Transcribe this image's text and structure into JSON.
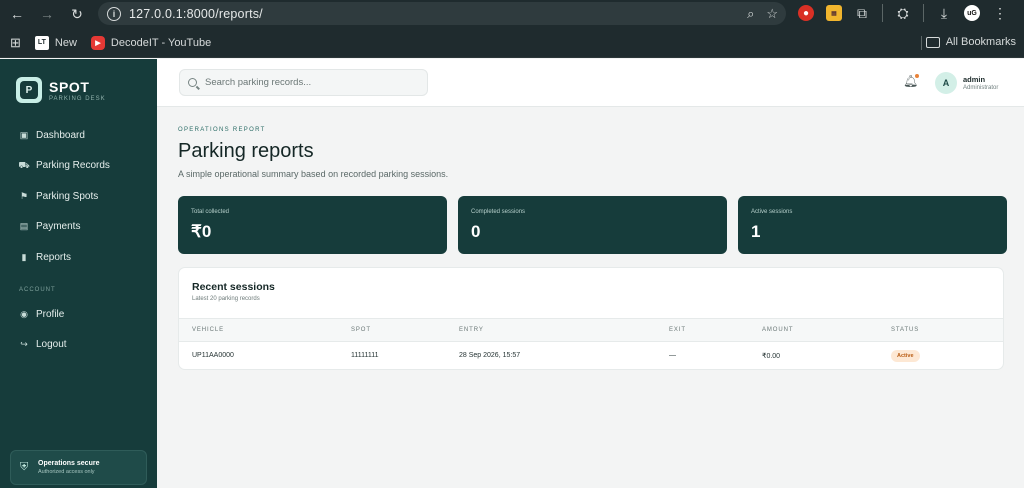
{
  "browser": {
    "url": "127.0.0.1:8000/reports/",
    "bookmarks": [
      {
        "label": "New",
        "icon": "lit"
      },
      {
        "label": "DecodeIT - YouTube",
        "icon": "yt"
      }
    ],
    "all_bookmarks": "All Bookmarks",
    "profile_initials": "uG"
  },
  "brand": {
    "logo_letter": "P",
    "name": "SPOT",
    "subtitle": "PARKING DESK"
  },
  "sidebar": {
    "items": [
      {
        "label": "Dashboard",
        "icon": "dashboard-icon",
        "glyph": "▣"
      },
      {
        "label": "Parking Records",
        "icon": "car-icon",
        "glyph": "⛟"
      },
      {
        "label": "Parking Spots",
        "icon": "signpost-icon",
        "glyph": "⚑"
      },
      {
        "label": "Payments",
        "icon": "wallet-icon",
        "glyph": "▤"
      },
      {
        "label": "Reports",
        "icon": "chart-icon",
        "glyph": "▮"
      }
    ],
    "section_label": "ACCOUNT",
    "account_items": [
      {
        "label": "Profile",
        "icon": "user-icon",
        "glyph": "◉"
      },
      {
        "label": "Logout",
        "icon": "logout-icon",
        "glyph": "↪"
      }
    ],
    "secure": {
      "title": "Operations secure",
      "subtitle": "Authorized access only"
    }
  },
  "topbar": {
    "search_placeholder": "Search parking records...",
    "user_initial": "A",
    "user_name": "admin",
    "user_role": "Administrator"
  },
  "page": {
    "eyebrow": "OPERATIONS REPORT",
    "title": "Parking reports",
    "subtitle": "A simple operational summary based on recorded parking sessions."
  },
  "stats": [
    {
      "label": "Total collected",
      "value": "₹0"
    },
    {
      "label": "Completed sessions",
      "value": "0"
    },
    {
      "label": "Active sessions",
      "value": "1"
    }
  ],
  "recent": {
    "title": "Recent sessions",
    "subtitle": "Latest 20 parking records",
    "columns": [
      "VEHICLE",
      "SPOT",
      "ENTRY",
      "EXIT",
      "AMOUNT",
      "STATUS"
    ],
    "rows": [
      {
        "vehicle": "UP11AA0000",
        "spot": "11111111",
        "entry": "28 Sep 2026, 15:57",
        "exit": "—",
        "amount": "₹0.00",
        "status": "Active"
      }
    ]
  },
  "colors": {
    "sidebar_bg": "#163c3b",
    "stat_bg": "#163c3b",
    "status_active_bg": "#fde8d4",
    "status_active_text": "#b85b12"
  }
}
